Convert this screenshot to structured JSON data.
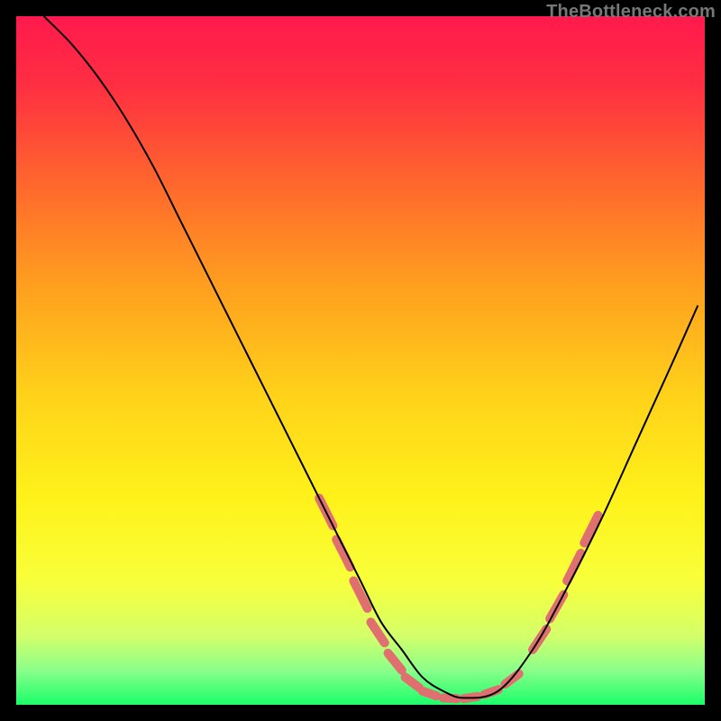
{
  "watermark": "TheBottleneck.com",
  "chart_data": {
    "type": "line",
    "title": "",
    "xlabel": "",
    "ylabel": "",
    "xlim": [
      0,
      100
    ],
    "ylim": [
      0,
      100
    ],
    "grid": false,
    "legend": false,
    "series": [
      {
        "name": "curve",
        "stroke": "#000000",
        "stroke_width": 2,
        "x": [
          4,
          8,
          12,
          16,
          20,
          24,
          28,
          32,
          36,
          40,
          44,
          47,
          50,
          53,
          56,
          59,
          62,
          65,
          70,
          75,
          80,
          85,
          90,
          95,
          99
        ],
        "y": [
          100,
          96,
          91,
          85,
          78,
          70,
          62,
          54,
          46,
          38,
          30,
          24,
          18,
          12,
          8,
          4,
          2,
          1,
          2,
          8,
          17,
          27,
          38,
          49,
          58
        ]
      }
    ],
    "marker_groups": [
      {
        "name": "left-cluster",
        "stroke": "#e07070",
        "stroke_width": 10,
        "linecap": "round",
        "segments": [
          {
            "x": [
              44.0,
              46.0
            ],
            "y": [
              30.0,
              26.0
            ]
          },
          {
            "x": [
              46.5,
              48.5
            ],
            "y": [
              24.0,
              20.0
            ]
          },
          {
            "x": [
              49.0,
              51.0
            ],
            "y": [
              18.0,
              14.0
            ]
          },
          {
            "x": [
              51.5,
              53.5
            ],
            "y": [
              12.0,
              9.0
            ]
          },
          {
            "x": [
              54.0,
              56.0
            ],
            "y": [
              7.5,
              5.0
            ]
          },
          {
            "x": [
              56.5,
              58.5
            ],
            "y": [
              4.0,
              2.5
            ]
          }
        ]
      },
      {
        "name": "bottom-cluster",
        "stroke": "#e07070",
        "stroke_width": 10,
        "linecap": "round",
        "segments": [
          {
            "x": [
              59.0,
              61.0
            ],
            "y": [
              2.0,
              1.3
            ]
          },
          {
            "x": [
              62.0,
              64.0
            ],
            "y": [
              1.0,
              0.9
            ]
          },
          {
            "x": [
              65.0,
              67.0
            ],
            "y": [
              0.9,
              1.2
            ]
          },
          {
            "x": [
              68.0,
              70.0
            ],
            "y": [
              1.5,
              2.2
            ]
          },
          {
            "x": [
              71.0,
              73.0
            ],
            "y": [
              3.0,
              4.5
            ]
          }
        ]
      },
      {
        "name": "right-cluster",
        "stroke": "#e07070",
        "stroke_width": 10,
        "linecap": "round",
        "segments": [
          {
            "x": [
              75.0,
              77.0
            ],
            "y": [
              8.0,
              11.0
            ]
          },
          {
            "x": [
              77.5,
              79.5
            ],
            "y": [
              12.5,
              16.0
            ]
          },
          {
            "x": [
              80.0,
              82.0
            ],
            "y": [
              18.0,
              22.0
            ]
          },
          {
            "x": [
              82.5,
              84.5
            ],
            "y": [
              23.5,
              27.5
            ]
          }
        ]
      }
    ],
    "gradient_background": {
      "type": "linear-vertical",
      "stops": [
        {
          "offset": 0.0,
          "color": "#ff1a4d"
        },
        {
          "offset": 0.1,
          "color": "#ff2e42"
        },
        {
          "offset": 0.25,
          "color": "#ff6a2c"
        },
        {
          "offset": 0.4,
          "color": "#ffa21e"
        },
        {
          "offset": 0.55,
          "color": "#ffd21a"
        },
        {
          "offset": 0.7,
          "color": "#fff21a"
        },
        {
          "offset": 0.82,
          "color": "#f8ff3a"
        },
        {
          "offset": 0.9,
          "color": "#d4ff6a"
        },
        {
          "offset": 0.95,
          "color": "#8aff8a"
        },
        {
          "offset": 1.0,
          "color": "#1aff6a"
        }
      ]
    }
  }
}
